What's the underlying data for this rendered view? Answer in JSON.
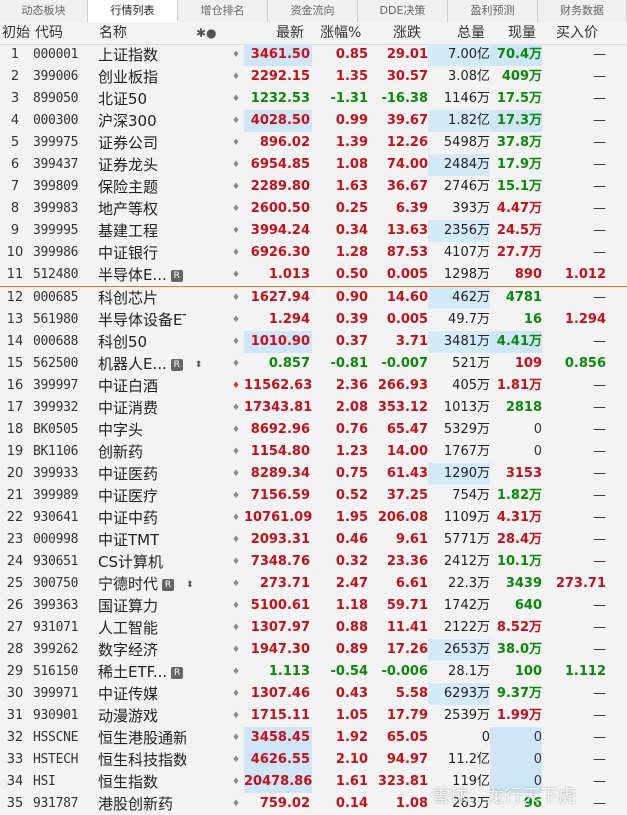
{
  "tabs": [
    "动态板块",
    "行情列表",
    "增仓排名",
    "资金流向",
    "DDE决策",
    "盈利预测",
    "财务数据"
  ],
  "active_tab": 1,
  "header": {
    "idx": "初始",
    "code": "代码",
    "name": "名称",
    "icons": "✱●",
    "latest": "最新",
    "pct": "涨幅%",
    "chg": "涨跌",
    "vol": "总量",
    "cur": "现量",
    "bid": "买入价"
  },
  "rows": [
    {
      "idx": "1",
      "code": "000001",
      "name": "上证指数",
      "latest": "3461.50",
      "pct": "0.85",
      "chg": "29.01",
      "vol": "7.00亿",
      "cur": "70.4万",
      "bid": "—",
      "dir": "up",
      "curc": "green",
      "hlL": true,
      "hlV": true,
      "hlC": true
    },
    {
      "idx": "2",
      "code": "399006",
      "name": "创业板指",
      "latest": "2292.15",
      "pct": "1.35",
      "chg": "30.57",
      "vol": "3.08亿",
      "cur": "409万",
      "bid": "—",
      "dir": "up",
      "curc": "green"
    },
    {
      "idx": "3",
      "code": "899050",
      "name": "北证50",
      "latest": "1232.53",
      "pct": "-1.31",
      "chg": "-16.38",
      "vol": "1146万",
      "cur": "17.5万",
      "bid": "—",
      "dir": "down",
      "curc": "green"
    },
    {
      "idx": "4",
      "code": "000300",
      "name": "沪深300",
      "latest": "4028.50",
      "pct": "0.99",
      "chg": "39.67",
      "vol": "1.82亿",
      "cur": "17.3万",
      "bid": "—",
      "dir": "up",
      "curc": "green",
      "hlL": true,
      "hlV": true,
      "hlC": true
    },
    {
      "idx": "5",
      "code": "399975",
      "name": "证券公司",
      "latest": "896.02",
      "pct": "1.39",
      "chg": "12.26",
      "vol": "5498万",
      "cur": "37.8万",
      "bid": "—",
      "dir": "up",
      "curc": "green"
    },
    {
      "idx": "6",
      "code": "399437",
      "name": "证券龙头",
      "latest": "6954.85",
      "pct": "1.08",
      "chg": "74.00",
      "vol": "2484万",
      "cur": "17.9万",
      "bid": "—",
      "dir": "up",
      "curc": "green",
      "hlV": true
    },
    {
      "idx": "7",
      "code": "399809",
      "name": "保险主题",
      "latest": "2289.80",
      "pct": "1.63",
      "chg": "36.67",
      "vol": "2746万",
      "cur": "15.1万",
      "bid": "—",
      "dir": "up",
      "curc": "green"
    },
    {
      "idx": "8",
      "code": "399983",
      "name": "地产等权",
      "latest": "2600.50",
      "pct": "0.25",
      "chg": "6.39",
      "vol": "393万",
      "cur": "4.47万",
      "bid": "—",
      "dir": "up",
      "curc": "red"
    },
    {
      "idx": "9",
      "code": "399995",
      "name": "基建工程",
      "latest": "3994.24",
      "pct": "0.34",
      "chg": "13.63",
      "vol": "2356万",
      "cur": "24.5万",
      "bid": "—",
      "dir": "up",
      "curc": "red",
      "hlV": true
    },
    {
      "idx": "10",
      "code": "399986",
      "name": "中证银行",
      "latest": "6926.30",
      "pct": "1.28",
      "chg": "87.53",
      "vol": "4107万",
      "cur": "27.7万",
      "bid": "—",
      "dir": "up",
      "curc": "red"
    },
    {
      "idx": "11",
      "code": "512480",
      "name": "半导体E...",
      "latest": "1.013",
      "pct": "0.50",
      "chg": "0.005",
      "vol": "1298万",
      "cur": "890",
      "bid": "1.012",
      "dir": "up",
      "curc": "red",
      "bidc": "red",
      "badge": "R"
    },
    {
      "idx": "12",
      "code": "000685",
      "name": "科创芯片",
      "latest": "1627.94",
      "pct": "0.90",
      "chg": "14.60",
      "vol": "462万",
      "cur": "4781",
      "bid": "—",
      "dir": "up",
      "curc": "green",
      "hlV": true,
      "sep": true
    },
    {
      "idx": "13",
      "code": "561980",
      "name": "半导体设备ETF",
      "latest": "1.294",
      "pct": "0.39",
      "chg": "0.005",
      "vol": "49.7万",
      "cur": "16",
      "bid": "1.294",
      "dir": "up",
      "curc": "green",
      "bidc": "red"
    },
    {
      "idx": "14",
      "code": "000688",
      "name": "科创50",
      "latest": "1010.90",
      "pct": "0.37",
      "chg": "3.71",
      "vol": "3481万",
      "cur": "4.41万",
      "bid": "—",
      "dir": "up",
      "curc": "green",
      "hlL": true,
      "hlV": true,
      "hlC": true
    },
    {
      "idx": "15",
      "code": "562500",
      "name": "机器人E...",
      "latest": "0.857",
      "pct": "-0.81",
      "chg": "-0.007",
      "vol": "521万",
      "cur": "109",
      "bid": "0.856",
      "dir": "down",
      "curc": "red",
      "bidc": "green",
      "badge": "R",
      "updown": true
    },
    {
      "idx": "16",
      "code": "399997",
      "name": "中证白酒",
      "latest": "11562.63",
      "pct": "2.36",
      "chg": "266.93",
      "vol": "405万",
      "cur": "1.81万",
      "bid": "—",
      "dir": "up",
      "curc": "red",
      "bellAlert": true
    },
    {
      "idx": "17",
      "code": "399932",
      "name": "中证消费",
      "latest": "17343.81",
      "pct": "2.08",
      "chg": "353.12",
      "vol": "1013万",
      "cur": "2818",
      "bid": "—",
      "dir": "up",
      "curc": "green"
    },
    {
      "idx": "18",
      "code": "BK0505",
      "name": "中字头",
      "latest": "8692.96",
      "pct": "0.76",
      "chg": "65.47",
      "vol": "5329万",
      "cur": "0",
      "bid": "—",
      "dir": "up",
      "curc": "plain"
    },
    {
      "idx": "19",
      "code": "BK1106",
      "name": "创新药",
      "latest": "1154.80",
      "pct": "1.23",
      "chg": "14.00",
      "vol": "1767万",
      "cur": "0",
      "bid": "—",
      "dir": "up",
      "curc": "plain"
    },
    {
      "idx": "20",
      "code": "399933",
      "name": "中证医药",
      "latest": "8289.34",
      "pct": "0.75",
      "chg": "61.43",
      "vol": "1290万",
      "cur": "3153",
      "bid": "—",
      "dir": "up",
      "curc": "red",
      "hlV": true
    },
    {
      "idx": "21",
      "code": "399989",
      "name": "中证医疗",
      "latest": "7156.59",
      "pct": "0.52",
      "chg": "37.25",
      "vol": "754万",
      "cur": "1.82万",
      "bid": "—",
      "dir": "up",
      "curc": "green"
    },
    {
      "idx": "22",
      "code": "930641",
      "name": "中证中药",
      "latest": "10761.09",
      "pct": "1.95",
      "chg": "206.08",
      "vol": "1109万",
      "cur": "4.31万",
      "bid": "—",
      "dir": "up",
      "curc": "red"
    },
    {
      "idx": "23",
      "code": "000998",
      "name": "中证TMT",
      "latest": "2093.31",
      "pct": "0.46",
      "chg": "9.61",
      "vol": "5771万",
      "cur": "28.4万",
      "bid": "—",
      "dir": "up",
      "curc": "red"
    },
    {
      "idx": "24",
      "code": "930651",
      "name": "CS计算机",
      "latest": "7348.76",
      "pct": "0.32",
      "chg": "23.36",
      "vol": "2412万",
      "cur": "10.1万",
      "bid": "—",
      "dir": "up",
      "curc": "green"
    },
    {
      "idx": "25",
      "code": "300750",
      "name": "宁德时代",
      "latest": "273.71",
      "pct": "2.47",
      "chg": "6.61",
      "vol": "22.3万",
      "cur": "3439",
      "bid": "273.71",
      "dir": "up",
      "curc": "green",
      "bidc": "red",
      "badge": "R",
      "updown": true
    },
    {
      "idx": "26",
      "code": "399363",
      "name": "国证算力",
      "latest": "5100.61",
      "pct": "1.18",
      "chg": "59.71",
      "vol": "1742万",
      "cur": "640",
      "bid": "—",
      "dir": "up",
      "curc": "green"
    },
    {
      "idx": "27",
      "code": "931071",
      "name": "人工智能",
      "latest": "1307.97",
      "pct": "0.88",
      "chg": "11.41",
      "vol": "2122万",
      "cur": "8.52万",
      "bid": "—",
      "dir": "up",
      "curc": "red"
    },
    {
      "idx": "28",
      "code": "399262",
      "name": "数字经济",
      "latest": "1947.30",
      "pct": "0.89",
      "chg": "17.26",
      "vol": "2653万",
      "cur": "38.0万",
      "bid": "—",
      "dir": "up",
      "curc": "green",
      "hlV": true
    },
    {
      "idx": "29",
      "code": "516150",
      "name": "稀土ETF...",
      "latest": "1.113",
      "pct": "-0.54",
      "chg": "-0.006",
      "vol": "28.1万",
      "cur": "100",
      "bid": "1.112",
      "dir": "down",
      "curc": "green",
      "bidc": "green",
      "badge": "R"
    },
    {
      "idx": "30",
      "code": "399971",
      "name": "中证传媒",
      "latest": "1307.46",
      "pct": "0.43",
      "chg": "5.58",
      "vol": "6293万",
      "cur": "9.37万",
      "bid": "—",
      "dir": "up",
      "curc": "green",
      "hlV": true
    },
    {
      "idx": "31",
      "code": "930901",
      "name": "动漫游戏",
      "latest": "1715.11",
      "pct": "1.05",
      "chg": "17.79",
      "vol": "2539万",
      "cur": "1.99万",
      "bid": "—",
      "dir": "up",
      "curc": "red"
    },
    {
      "idx": "32",
      "code": "HSSCNE",
      "name": "恒生港股通新经...",
      "latest": "3458.45",
      "pct": "1.92",
      "chg": "65.05",
      "vol": "0",
      "cur": "0",
      "bid": "—",
      "dir": "up",
      "curc": "plain",
      "hlL": true,
      "hlC": true
    },
    {
      "idx": "33",
      "code": "HSTECH",
      "name": "恒生科技指数",
      "latest": "4626.55",
      "pct": "2.10",
      "chg": "94.97",
      "vol": "11.2亿",
      "cur": "0",
      "bid": "—",
      "dir": "up",
      "curc": "plain",
      "hlL": true,
      "hlC": true
    },
    {
      "idx": "34",
      "code": "HSI",
      "name": "恒生指数",
      "latest": "20478.86",
      "pct": "1.61",
      "chg": "323.81",
      "vol": "119亿",
      "cur": "0",
      "bid": "—",
      "dir": "up",
      "curc": "plain",
      "hlL": true,
      "hlC": true
    },
    {
      "idx": "35",
      "code": "931787",
      "name": "港股创新药",
      "latest": "759.02",
      "pct": "0.14",
      "chg": "1.08",
      "vol": "263万",
      "cur": "96",
      "bid": "—",
      "dir": "up",
      "curc": "green"
    }
  ],
  "watermark": "雪球：龙行天下虎",
  "colors": {
    "up": "#c8101a",
    "down": "#0a8a0a",
    "highlight": "#cfe6f8",
    "separator": "#e07a2e"
  }
}
